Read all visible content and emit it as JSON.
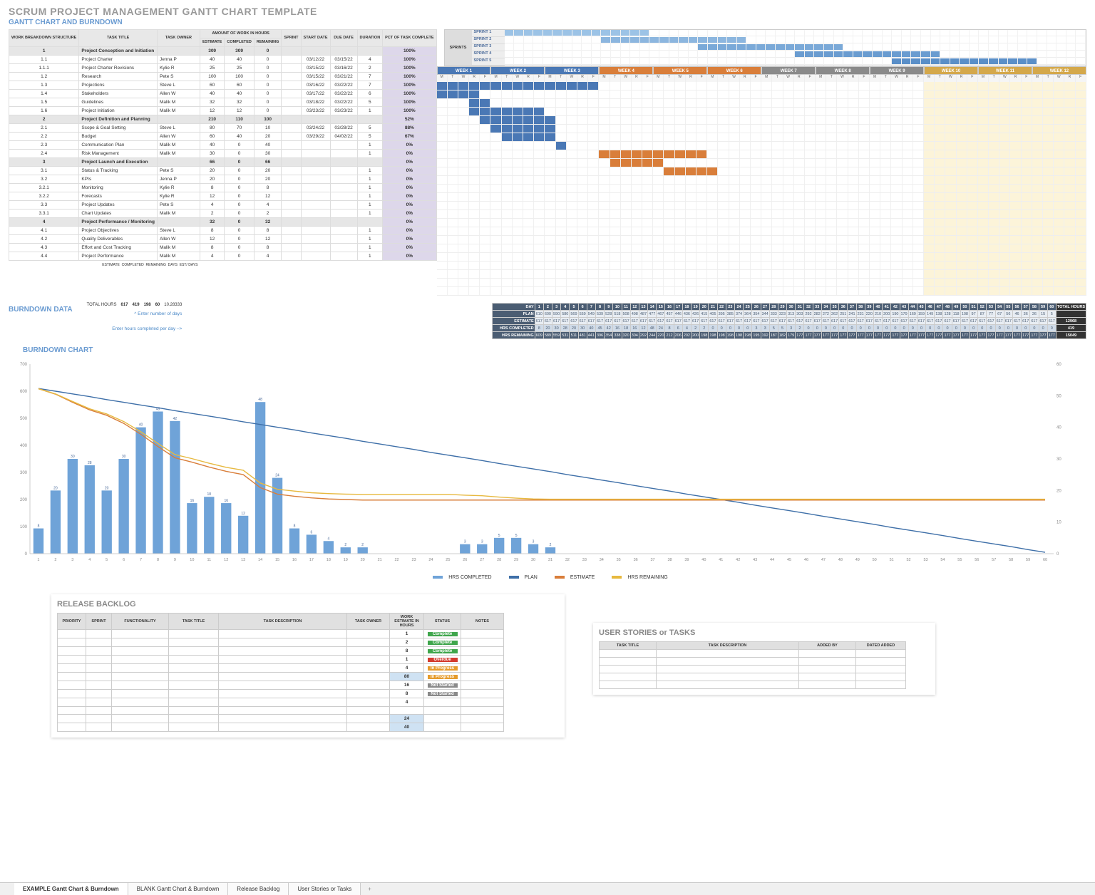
{
  "titles": {
    "main": "SCRUM PROJECT MANAGEMENT GANTT CHART TEMPLATE",
    "sub": "GANTT CHART AND BURNDOWN",
    "burndown_data": "BURNDOWN DATA",
    "burndown_chart": "BURNDOWN CHART",
    "release_backlog": "RELEASE BACKLOG",
    "user_stories": "USER STORIES or TASKS"
  },
  "task_headers": {
    "wbs": "WORK BREAKDOWN STRUCTURE",
    "title": "TASK TITLE",
    "owner": "TASK OWNER",
    "amount_group": "AMOUNT OF WORK IN HOURS",
    "estimate": "ESTIMATE",
    "completed": "COMPLETED",
    "remaining": "REMAINING",
    "sprint": "SPRINT",
    "start": "START DATE",
    "due": "DUE DATE",
    "duration": "DURATION",
    "pct": "PCT OF TASK COMPLETE"
  },
  "tasks": [
    {
      "wbs": "1",
      "title": "Project Conception and Initiation",
      "owner": "",
      "est": 309,
      "comp": 309,
      "rem": 0,
      "sprint": "",
      "start": "",
      "due": "",
      "dur": "",
      "pct": "100%",
      "summary": true,
      "bar_start": 0,
      "bar_len": 15,
      "bar_color": "#4A78B5"
    },
    {
      "wbs": "1.1",
      "title": "Project Charter",
      "owner": "Jenna P",
      "est": 40,
      "comp": 40,
      "rem": 0,
      "sprint": "",
      "start": "03/12/22",
      "due": "03/15/22",
      "dur": 4,
      "pct": "100%",
      "bar_start": 0,
      "bar_len": 4,
      "bar_color": "#4A78B5"
    },
    {
      "wbs": "1.1.1",
      "title": "Project Charter Revisions",
      "owner": "Kylie R",
      "est": 25,
      "comp": 25,
      "rem": 0,
      "sprint": "",
      "start": "03/15/22",
      "due": "03/16/22",
      "dur": 2,
      "pct": "100%",
      "bar_start": 3,
      "bar_len": 2,
      "bar_color": "#4A78B5"
    },
    {
      "wbs": "1.2",
      "title": "Research",
      "owner": "Pete S",
      "est": 100,
      "comp": 100,
      "rem": 0,
      "sprint": "",
      "start": "03/15/22",
      "due": "03/21/22",
      "dur": 7,
      "pct": "100%",
      "bar_start": 3,
      "bar_len": 7,
      "bar_color": "#4A78B5"
    },
    {
      "wbs": "1.3",
      "title": "Projections",
      "owner": "Steve L",
      "est": 60,
      "comp": 60,
      "rem": 0,
      "sprint": "",
      "start": "03/16/22",
      "due": "03/22/22",
      "dur": 7,
      "pct": "100%",
      "bar_start": 4,
      "bar_len": 7,
      "bar_color": "#4A78B5"
    },
    {
      "wbs": "1.4",
      "title": "Stakeholders",
      "owner": "Allen W",
      "est": 40,
      "comp": 40,
      "rem": 0,
      "sprint": "",
      "start": "03/17/22",
      "due": "03/22/22",
      "dur": 6,
      "pct": "100%",
      "bar_start": 5,
      "bar_len": 6,
      "bar_color": "#4A78B5"
    },
    {
      "wbs": "1.5",
      "title": "Guidelines",
      "owner": "Malik M",
      "est": 32,
      "comp": 32,
      "rem": 0,
      "sprint": "",
      "start": "03/18/22",
      "due": "03/22/22",
      "dur": 5,
      "pct": "100%",
      "bar_start": 6,
      "bar_len": 5,
      "bar_color": "#4A78B5"
    },
    {
      "wbs": "1.6",
      "title": "Project Initiation",
      "owner": "Malik M",
      "est": 12,
      "comp": 12,
      "rem": 0,
      "sprint": "",
      "start": "03/23/22",
      "due": "03/23/22",
      "dur": 1,
      "pct": "100%",
      "bar_start": 11,
      "bar_len": 1,
      "bar_color": "#4A78B5"
    },
    {
      "wbs": "2",
      "title": "Project Definition and Planning",
      "owner": "",
      "est": 210,
      "comp": 110,
      "rem": 100,
      "sprint": "",
      "start": "",
      "due": "",
      "dur": "",
      "pct": "52%",
      "summary": true,
      "bar_start": 15,
      "bar_len": 10,
      "bar_color": "#D97E3A"
    },
    {
      "wbs": "2.1",
      "title": "Scope & Goal Setting",
      "owner": "Steve L",
      "est": 80,
      "comp": 70,
      "rem": 10,
      "sprint": "",
      "start": "03/24/22",
      "due": "03/28/22",
      "dur": 5,
      "pct": "88%",
      "bar_start": 16,
      "bar_len": 5,
      "bar_color": "#D97E3A"
    },
    {
      "wbs": "2.2",
      "title": "Budget",
      "owner": "Allen W",
      "est": 60,
      "comp": 40,
      "rem": 20,
      "sprint": "",
      "start": "03/29/22",
      "due": "04/02/22",
      "dur": 5,
      "pct": "67%",
      "bar_start": 21,
      "bar_len": 5,
      "bar_color": "#D97E3A"
    },
    {
      "wbs": "2.3",
      "title": "Communication Plan",
      "owner": "Malik M",
      "est": 40,
      "comp": 0,
      "rem": 40,
      "sprint": "",
      "start": "",
      "due": "",
      "dur": 1,
      "pct": "0%"
    },
    {
      "wbs": "2.4",
      "title": "Risk Management",
      "owner": "Malik M",
      "est": 30,
      "comp": 0,
      "rem": 30,
      "sprint": "",
      "start": "",
      "due": "",
      "dur": 1,
      "pct": "0%"
    },
    {
      "wbs": "3",
      "title": "Project Launch and Execution",
      "owner": "",
      "est": 66,
      "comp": 0,
      "rem": 66,
      "sprint": "",
      "start": "",
      "due": "",
      "dur": "",
      "pct": "0%",
      "summary": true
    },
    {
      "wbs": "3.1",
      "title": "Status & Tracking",
      "owner": "Pete S",
      "est": 20,
      "comp": 0,
      "rem": 20,
      "sprint": "",
      "start": "",
      "due": "",
      "dur": 1,
      "pct": "0%"
    },
    {
      "wbs": "3.2",
      "title": "KPIs",
      "owner": "Jenna P",
      "est": 20,
      "comp": 0,
      "rem": 20,
      "sprint": "",
      "start": "",
      "due": "",
      "dur": 1,
      "pct": "0%"
    },
    {
      "wbs": "3.2.1",
      "title": "Monitoring",
      "owner": "Kylie R",
      "est": 8,
      "comp": 0,
      "rem": 8,
      "sprint": "",
      "start": "",
      "due": "",
      "dur": 1,
      "pct": "0%"
    },
    {
      "wbs": "3.2.2",
      "title": "Forecasts",
      "owner": "Kylie R",
      "est": 12,
      "comp": 0,
      "rem": 12,
      "sprint": "",
      "start": "",
      "due": "",
      "dur": 1,
      "pct": "0%"
    },
    {
      "wbs": "3.3",
      "title": "Project Updates",
      "owner": "Pete S",
      "est": 4,
      "comp": 0,
      "rem": 4,
      "sprint": "",
      "start": "",
      "due": "",
      "dur": 1,
      "pct": "0%"
    },
    {
      "wbs": "3.3.1",
      "title": "Chart Updates",
      "owner": "Malik M",
      "est": 2,
      "comp": 0,
      "rem": 2,
      "sprint": "",
      "start": "",
      "due": "",
      "dur": 1,
      "pct": "0%"
    },
    {
      "wbs": "4",
      "title": "Project Performance / Monitoring",
      "owner": "",
      "est": 32,
      "comp": 0,
      "rem": 32,
      "sprint": "",
      "start": "",
      "due": "",
      "dur": "",
      "pct": "0%",
      "summary": true
    },
    {
      "wbs": "4.1",
      "title": "Project Objectives",
      "owner": "Steve L",
      "est": 8,
      "comp": 0,
      "rem": 8,
      "sprint": "",
      "start": "",
      "due": "",
      "dur": 1,
      "pct": "0%"
    },
    {
      "wbs": "4.2",
      "title": "Quality Deliverables",
      "owner": "Allen W",
      "est": 12,
      "comp": 0,
      "rem": 12,
      "sprint": "",
      "start": "",
      "due": "",
      "dur": 1,
      "pct": "0%"
    },
    {
      "wbs": "4.3",
      "title": "Effort and Cost Tracking",
      "owner": "Malik M",
      "est": 8,
      "comp": 0,
      "rem": 8,
      "sprint": "",
      "start": "",
      "due": "",
      "dur": 1,
      "pct": "0%"
    },
    {
      "wbs": "4.4",
      "title": "Project Performance",
      "owner": "Malik M",
      "est": 4,
      "comp": 0,
      "rem": 4,
      "sprint": "",
      "start": "",
      "due": "",
      "dur": 1,
      "pct": "0%"
    }
  ],
  "sprints_hdr": "SPRINTS",
  "sprints": [
    {
      "name": "SPRINT 1",
      "start": 0,
      "len": 15,
      "color": "#9CC3E6"
    },
    {
      "name": "SPRINT 2",
      "start": 10,
      "len": 15,
      "color": "#8CB6DF"
    },
    {
      "name": "SPRINT 3",
      "start": 20,
      "len": 15,
      "color": "#7AA9D8"
    },
    {
      "name": "SPRINT 4",
      "start": 30,
      "len": 15,
      "color": "#6A9CD0"
    },
    {
      "name": "SPRINT 5",
      "start": 40,
      "len": 15,
      "color": "#5A8FC8"
    }
  ],
  "weeks": [
    {
      "label": "WEEK 1",
      "color": "#4A78B5"
    },
    {
      "label": "WEEK 2",
      "color": "#4A78B5"
    },
    {
      "label": "WEEK 3",
      "color": "#4A78B5"
    },
    {
      "label": "WEEK 4",
      "color": "#D97E3A"
    },
    {
      "label": "WEEK 5",
      "color": "#D97E3A"
    },
    {
      "label": "WEEK 6",
      "color": "#D97E3A"
    },
    {
      "label": "WEEK 7",
      "color": "#8A8A8A"
    },
    {
      "label": "WEEK 8",
      "color": "#8A8A8A"
    },
    {
      "label": "WEEK 9",
      "color": "#8A8A8A"
    },
    {
      "label": "WEEK 10",
      "color": "#D4A84B"
    },
    {
      "label": "WEEK 11",
      "color": "#D4A84B"
    },
    {
      "label": "WEEK 12",
      "color": "#D4A84B"
    }
  ],
  "days": [
    "M",
    "T",
    "W",
    "R",
    "F"
  ],
  "summary_row": {
    "labels": [
      "ESTIMATE",
      "COMPLETED",
      "REMAINING",
      "DAYS",
      "EST/ DAYS"
    ],
    "total_hours_label": "TOTAL HOURS",
    "est": 617,
    "comp": 419,
    "rem": 198,
    "days": 60,
    "est_days": "10.28333"
  },
  "hints": {
    "days": "^ Enter number of days",
    "hours": "Enter hours completed per day –>"
  },
  "burndown": {
    "labels": {
      "day": "DAY",
      "plan": "PLAN",
      "estimate": "ESTIMATE",
      "completed": "HRS COMPLETED",
      "remaining": "HRS REMAINING",
      "total": "TOTAL HOURS"
    },
    "days": 60,
    "plan": [
      610,
      600,
      590,
      580,
      569,
      559,
      549,
      539,
      528,
      518,
      508,
      498,
      487,
      477,
      467,
      457,
      446,
      436,
      426,
      415,
      405,
      395,
      385,
      374,
      364,
      354,
      344,
      333,
      323,
      313,
      303,
      292,
      282,
      272,
      262,
      251,
      241,
      231,
      220,
      210,
      200,
      190,
      179,
      169,
      159,
      149,
      138,
      128,
      118,
      108,
      97,
      87,
      77,
      67,
      56,
      46,
      36,
      26,
      15,
      5
    ],
    "estimate": [
      617,
      617,
      617,
      617,
      617,
      617,
      617,
      617,
      617,
      617,
      617,
      617,
      617,
      617,
      617,
      617,
      617,
      617,
      617,
      617,
      617,
      617,
      617,
      617,
      617,
      617,
      617,
      617,
      617,
      617,
      617,
      617,
      617,
      617,
      617,
      617,
      617,
      617,
      617,
      617,
      617,
      617,
      617,
      617,
      617,
      617,
      617,
      617,
      617,
      617,
      617,
      617,
      617,
      617,
      617,
      617,
      617,
      617,
      617,
      617
    ],
    "hrs_completed": [
      8,
      20,
      30,
      28,
      20,
      30,
      40,
      45,
      42,
      16,
      18,
      16,
      12,
      48,
      24,
      8,
      6,
      4,
      2,
      2,
      0,
      0,
      0,
      0,
      0,
      3,
      3,
      5,
      5,
      3,
      2,
      0,
      0,
      0,
      0,
      0,
      0,
      0,
      0,
      0,
      0,
      0,
      0,
      0,
      0,
      0,
      0,
      0,
      0,
      0,
      0,
      0,
      0,
      0,
      0,
      0,
      0,
      0,
      0,
      0
    ],
    "hrs_remaining": [
      609,
      589,
      559,
      531,
      511,
      481,
      441,
      396,
      354,
      338,
      320,
      304,
      292,
      244,
      220,
      212,
      206,
      202,
      200,
      198,
      198,
      198,
      198,
      198,
      198,
      195,
      192,
      187,
      182,
      179,
      177,
      177,
      177,
      177,
      177,
      177,
      177,
      177,
      177,
      177,
      177,
      177,
      177,
      177,
      177,
      177,
      177,
      177,
      177,
      177,
      177,
      177,
      177,
      177,
      177,
      177,
      177,
      177,
      177,
      177
    ],
    "totals": {
      "estimate": 12968,
      "completed": 419,
      "remaining": 15049
    }
  },
  "chart_data": {
    "type": "bar+line",
    "title": "BURNDOWN CHART",
    "x": [
      1,
      2,
      3,
      4,
      5,
      6,
      7,
      8,
      9,
      10,
      11,
      12,
      13,
      14,
      15,
      16,
      17,
      18,
      19,
      20,
      21,
      22,
      23,
      24,
      25,
      26,
      27,
      28,
      29,
      30,
      31,
      32,
      33,
      34,
      35,
      36,
      37,
      38,
      39,
      40,
      41,
      42,
      43,
      44,
      45,
      46,
      47,
      48,
      49,
      50,
      51,
      52,
      53,
      54,
      55,
      56,
      57,
      58,
      59,
      60
    ],
    "series": [
      {
        "name": "HRS COMPLETED",
        "type": "bar",
        "axis": "right",
        "values": [
          8,
          20,
          30,
          28,
          20,
          30,
          40,
          45,
          42,
          16,
          18,
          16,
          12,
          48,
          24,
          8,
          6,
          4,
          2,
          2,
          0,
          0,
          0,
          0,
          0,
          3,
          3,
          5,
          5,
          3,
          2,
          0,
          0,
          0,
          0,
          0,
          0,
          0,
          0,
          0,
          0,
          0,
          0,
          0,
          0,
          0,
          0,
          0,
          0,
          0,
          0,
          0,
          0,
          0,
          0,
          0,
          0,
          0,
          0,
          0
        ],
        "color": "#6FA3D8"
      },
      {
        "name": "PLAN",
        "type": "line",
        "axis": "left",
        "values": [
          610,
          600,
          590,
          580,
          569,
          559,
          549,
          539,
          528,
          518,
          508,
          498,
          487,
          477,
          467,
          457,
          446,
          436,
          426,
          415,
          405,
          395,
          385,
          374,
          364,
          354,
          344,
          333,
          323,
          313,
          303,
          292,
          282,
          272,
          262,
          251,
          241,
          231,
          220,
          210,
          200,
          190,
          179,
          169,
          159,
          149,
          138,
          128,
          118,
          108,
          97,
          87,
          77,
          67,
          56,
          46,
          36,
          26,
          15,
          5
        ],
        "color": "#3E6FA8"
      },
      {
        "name": "ESTIMATE",
        "type": "line",
        "axis": "left",
        "values": [
          609,
          589,
          559,
          531,
          511,
          481,
          441,
          396,
          354,
          338,
          320,
          304,
          292,
          244,
          220,
          212,
          206,
          202,
          200,
          198,
          198,
          198,
          198,
          198,
          198,
          198,
          198,
          198,
          198,
          198,
          198,
          198,
          198,
          198,
          198,
          198,
          198,
          198,
          198,
          198,
          198,
          198,
          198,
          198,
          198,
          198,
          198,
          198,
          198,
          198,
          198,
          198,
          198,
          198,
          198,
          198,
          198,
          198,
          198,
          198
        ],
        "color": "#D97E3A"
      },
      {
        "name": "HRS REMAINING",
        "type": "line",
        "axis": "left",
        "values": [
          609,
          590,
          562,
          535,
          516,
          488,
          450,
          407,
          366,
          351,
          334,
          319,
          308,
          261,
          238,
          231,
          225,
          222,
          220,
          219,
          219,
          219,
          219,
          219,
          219,
          216,
          214,
          209,
          205,
          202,
          201,
          201,
          201,
          201,
          201,
          201,
          201,
          201,
          201,
          201,
          201,
          201,
          201,
          201,
          201,
          201,
          201,
          201,
          201,
          201,
          201,
          201,
          201,
          201,
          201,
          201,
          201,
          201,
          201,
          201
        ],
        "color": "#E7B93F"
      }
    ],
    "y_left": {
      "min": 0,
      "max": 700,
      "ticks": [
        0,
        100,
        200,
        300,
        400,
        500,
        600,
        700
      ]
    },
    "y_right": {
      "min": 0,
      "max": 60,
      "ticks": [
        0,
        10,
        20,
        30,
        40,
        50,
        60
      ]
    }
  },
  "backlog": {
    "headers": [
      "PRIORITY",
      "SPRINT",
      "FUNCTIONALITY",
      "TASK TITLE",
      "TASK DESCRIPTION",
      "TASK OWNER",
      "WORK ESTIMATE IN HOURS",
      "STATUS",
      "NOTES"
    ],
    "rows": [
      {
        "hours": 1,
        "status": "Complete",
        "status_color": "#3FA64C"
      },
      {
        "hours": 2,
        "status": "Complete",
        "status_color": "#3FA64C"
      },
      {
        "hours": 8,
        "status": "Complete",
        "status_color": "#3FA64C"
      },
      {
        "hours": 1,
        "status": "Overdue",
        "status_color": "#D43B2F"
      },
      {
        "hours": 4,
        "status": "In Progress",
        "status_color": "#E59B2C"
      },
      {
        "hours": 80,
        "status": "In Progress",
        "status_color": "#E59B2C",
        "highlight": true
      },
      {
        "hours": 16,
        "status": "Not Started",
        "status_color": "#8A8A8A"
      },
      {
        "hours": 8,
        "status": "Not Started",
        "status_color": "#8A8A8A"
      },
      {
        "hours": 4,
        "status": "",
        "status_color": ""
      },
      {
        "hours": "",
        "status": "",
        "status_color": ""
      },
      {
        "hours": 24,
        "status": "",
        "status_color": "",
        "highlight": true
      },
      {
        "hours": 40,
        "status": "",
        "status_color": "",
        "highlight": true
      }
    ]
  },
  "user_stories": {
    "headers": [
      "TASK TITLE",
      "TASK DESCRIPTION",
      "ADDED BY",
      "DATED ADDED"
    ]
  },
  "tabs": [
    {
      "label": "EXAMPLE Gantt Chart & Burndown",
      "active": true
    },
    {
      "label": "BLANK Gantt Chart & Burndown"
    },
    {
      "label": "Release Backlog"
    },
    {
      "label": "User Stories or Tasks"
    }
  ],
  "legend": [
    "HRS COMPLETED",
    "PLAN",
    "ESTIMATE",
    "HRS REMAINING"
  ]
}
